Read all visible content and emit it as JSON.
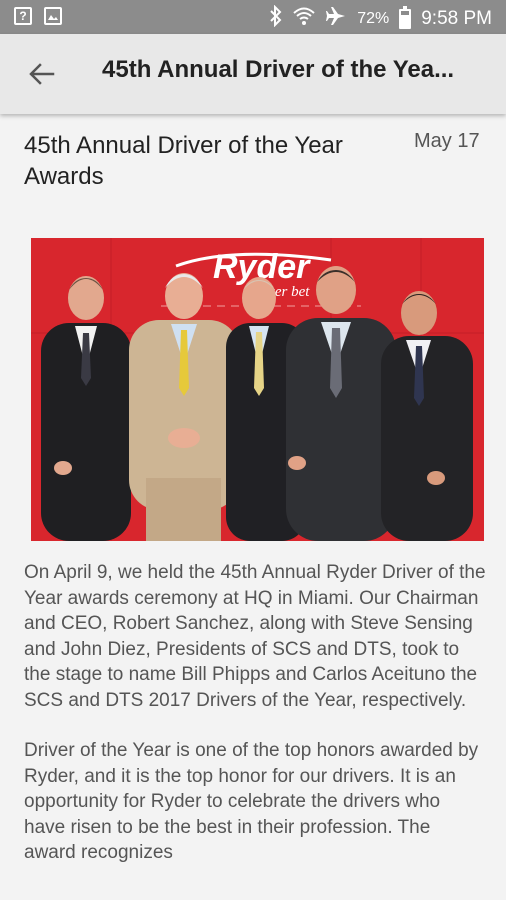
{
  "status_bar": {
    "battery": "72%",
    "time": "9:58 PM",
    "battery_level": 0.72,
    "icons": [
      "question-icon",
      "image-icon",
      "bluetooth-icon",
      "wifi-icon",
      "airplane-icon",
      "battery-icon"
    ]
  },
  "app_bar": {
    "title": "45th Annual Driver of the Yea...",
    "back_icon": "arrow-left-icon"
  },
  "article": {
    "title": "45th Annual Driver of the Year Awards",
    "date": "May 17",
    "photo_logo": "Ryder",
    "photo_tagline": "Ever bet",
    "paragraphs": [
      "On April 9, we held the 45th Annual Ryder Driver of the Year awards ceremony at HQ in Miami. Our Chairman and CEO, Robert Sanchez, along with Steve Sensing and John Diez, Presidents of SCS and DTS, took to the stage to name Bill Phipps and Carlos Aceituno the SCS and DTS 2017 Drivers of the Year, respectively.",
      "Driver of the Year is one of the top honors awarded by Ryder, and it is the top honor for our drivers. It is an opportunity for Ryder to celebrate the drivers who have risen to be the best in their profession. The award recognizes"
    ]
  },
  "colors": {
    "status_bar": "#8c8c8c",
    "app_bar": "#e8e8e8",
    "background": "#f3f3f3",
    "photo_backdrop": "#d8262d"
  }
}
